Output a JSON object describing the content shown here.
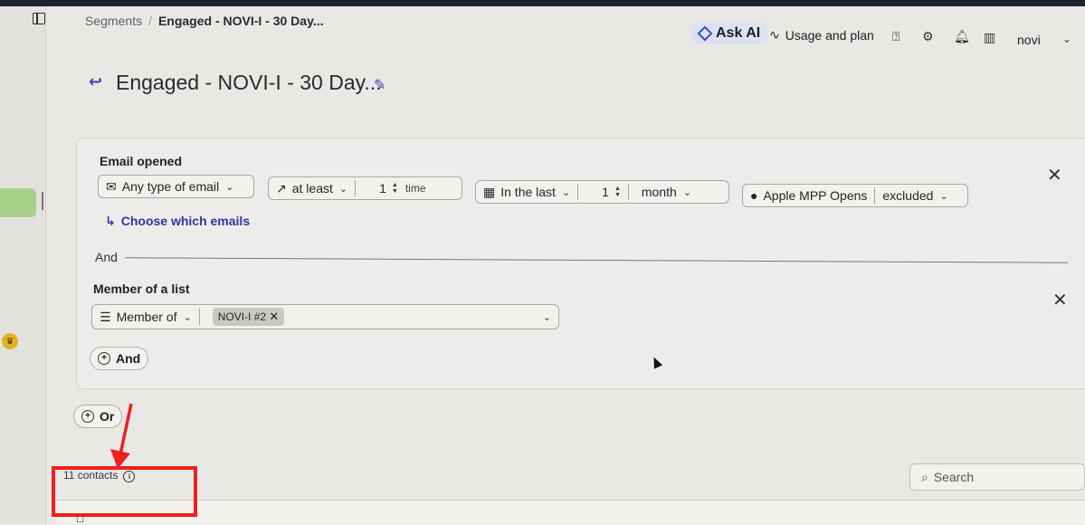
{
  "breadcrumb": {
    "root": "Segments",
    "current": "Engaged - NOVI-I - 30 Day..."
  },
  "topbar": {
    "ask_ai": "Ask AI",
    "usage_plan": "Usage and plan",
    "account": "novi"
  },
  "page": {
    "title": "Engaged - NOVI-I - 30 Day..."
  },
  "condition1": {
    "label": "Email opened",
    "email_type": "Any type of email",
    "frequency": "at least",
    "count": "1",
    "count_unit": "time",
    "timeframe": "In the last",
    "period_count": "1",
    "period_unit": "month",
    "mpp_label": "Apple MPP Opens",
    "mpp_value": "excluded",
    "choose_emails": "Choose which emails"
  },
  "connector": {
    "and": "And"
  },
  "condition2": {
    "label": "Member of a list",
    "operator": "Member of",
    "list_tag": "NOVI-I #2"
  },
  "buttons": {
    "and": "And",
    "or": "Or"
  },
  "results": {
    "count": "11 contacts"
  },
  "search": {
    "placeholder": "Search"
  },
  "annotation": {
    "color": "#ef1f1f"
  },
  "colors": {
    "accent": "#4041b8",
    "ask_ai_bg": "#dde2f2",
    "side_pill": "#a7d18a"
  }
}
